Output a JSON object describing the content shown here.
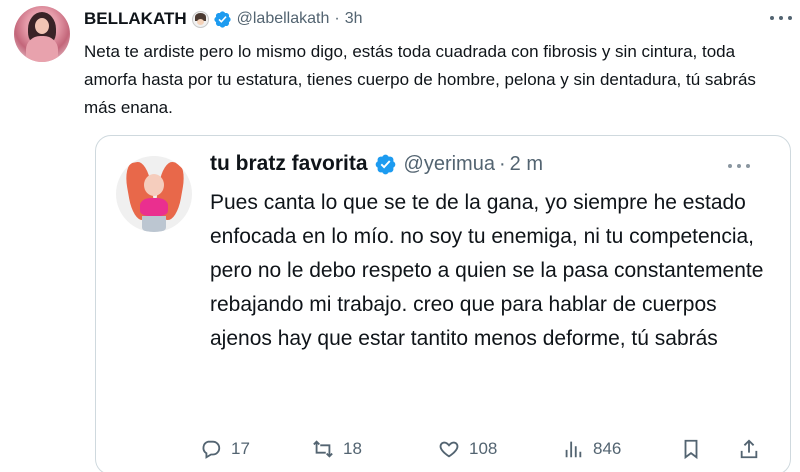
{
  "tweet": {
    "author_name": "BELLAKATH",
    "handle": "@labellakath",
    "separator": "·",
    "time": "3h",
    "text": "Neta te ardiste pero  lo mismo digo, estás toda cuadrada con fibrosis y sin cintura, toda amorfa hasta por tu estatura, tienes cuerpo de hombre, pelona y sin dentadura, tú sabrás más enana."
  },
  "quoted_tweet": {
    "author_name": "tu bratz favorita",
    "handle": "@yerimua",
    "separator": "·",
    "time": "2 m",
    "text": "Pues canta lo que se te de la gana, yo siempre he estado enfocada en lo mío. no soy tu enemiga, ni tu competencia, pero no le debo respeto a quien se la pasa constantemente rebajando mi trabajo. creo que para hablar de cuerpos ajenos hay que estar tantito menos deforme, tú sabrás",
    "stats": {
      "replies": "17",
      "retweets": "18",
      "likes": "108",
      "views": "846"
    }
  },
  "icons": [
    "verified-badge-icon",
    "woman-emoji-icon",
    "more-options-icon",
    "reply-icon",
    "retweet-icon",
    "like-icon",
    "views-icon",
    "bookmark-icon",
    "share-icon"
  ],
  "colors": {
    "verified": "#1d9bf0",
    "muted": "#536471",
    "text": "#0f1419",
    "border": "#cfd9de"
  }
}
